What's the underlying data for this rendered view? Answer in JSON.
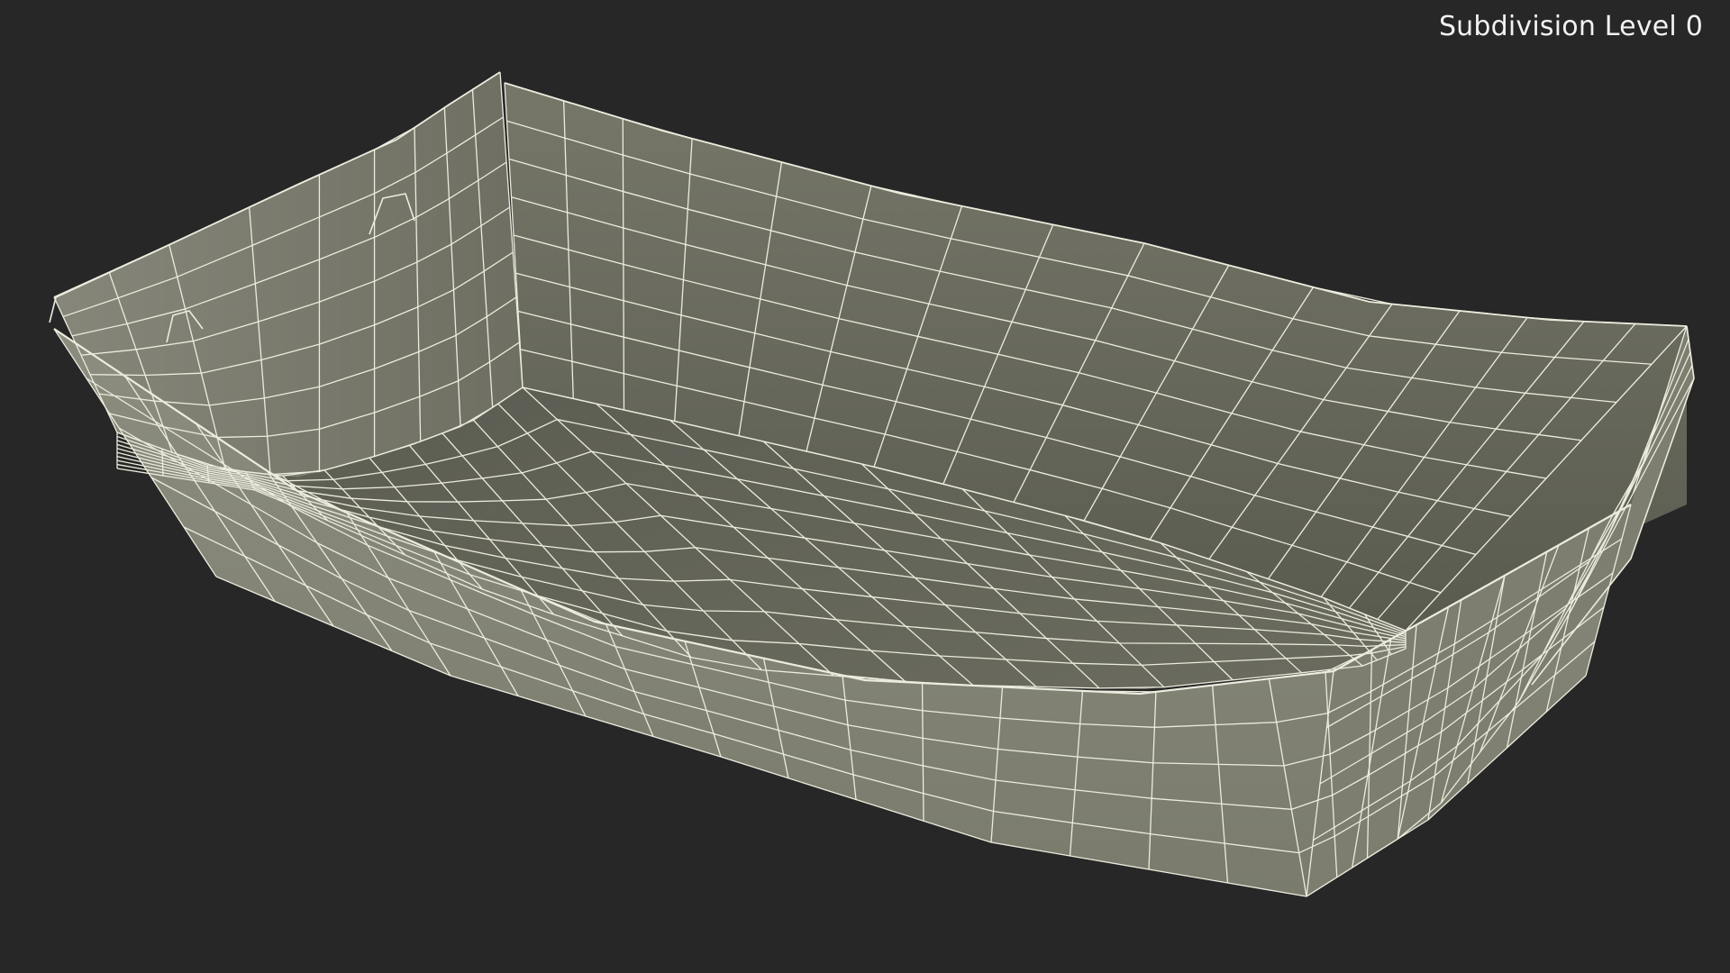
{
  "viewport": {
    "label": "Subdivision Level 0",
    "background_color": "#272727",
    "wire_color": "#ececde",
    "surface_light": "#8a8b7d",
    "surface_mid": "#727366",
    "surface_dark": "#55564b"
  },
  "model": {
    "subject": "paper food tray",
    "display_mode": "wireframe-on-shaded"
  }
}
